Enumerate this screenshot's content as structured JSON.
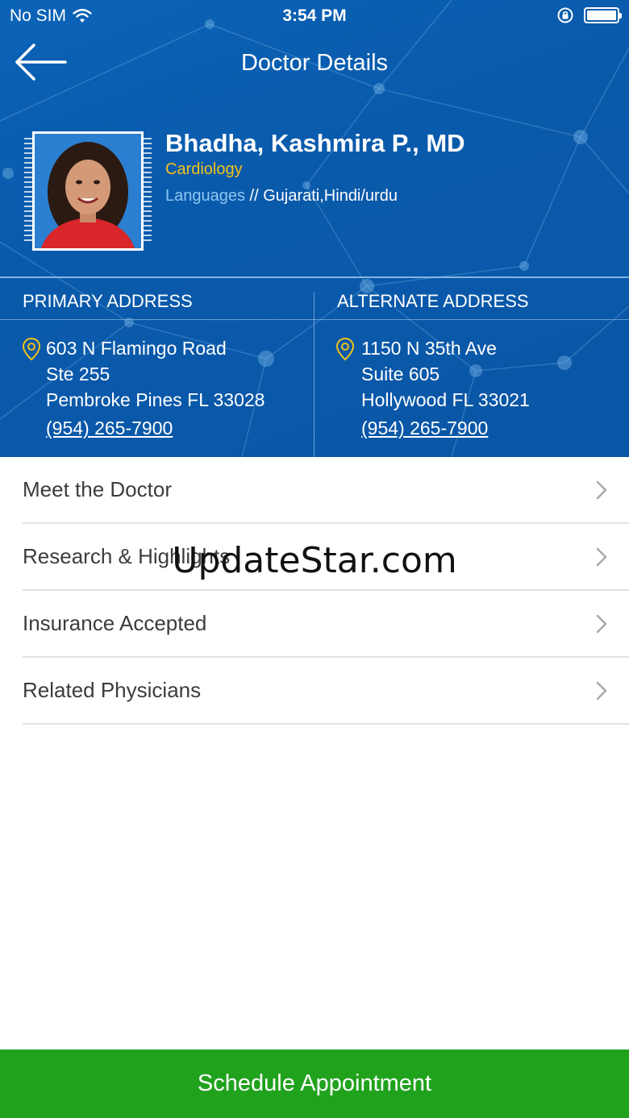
{
  "status_bar": {
    "carrier": "No SIM",
    "time": "3:54 PM"
  },
  "nav": {
    "title": "Doctor Details",
    "back_icon": "arrow-left-icon"
  },
  "doctor": {
    "name": "Bhadha, Kashmira P., MD",
    "specialty": "Cardiology",
    "languages_label": "Languages",
    "languages_value": "// Gujarati,Hindi/urdu"
  },
  "addresses": {
    "primary": {
      "heading": "PRIMARY ADDRESS",
      "line1": "603 N Flamingo Road",
      "line2": "Ste 255",
      "line3": "Pembroke Pines FL 33028",
      "phone": "(954) 265-7900"
    },
    "alternate": {
      "heading": "ALTERNATE ADDRESS",
      "line1": "1150 N 35th Ave",
      "line2": "Suite 605",
      "line3": "Hollywood FL 33021",
      "phone": "(954) 265-7900"
    }
  },
  "menu": {
    "items": [
      {
        "label": "Meet the Doctor"
      },
      {
        "label": "Research & Highlights"
      },
      {
        "label": "Insurance Accepted"
      },
      {
        "label": "Related Physicians"
      }
    ]
  },
  "watermark": "UpdateStar.com",
  "footer": {
    "schedule_label": "Schedule Appointment"
  },
  "colors": {
    "hero_blue": "#0a5aab",
    "specialty_yellow": "#f2c21a",
    "languages_label_blue": "#8cc6f2",
    "schedule_green": "#21a21d"
  }
}
